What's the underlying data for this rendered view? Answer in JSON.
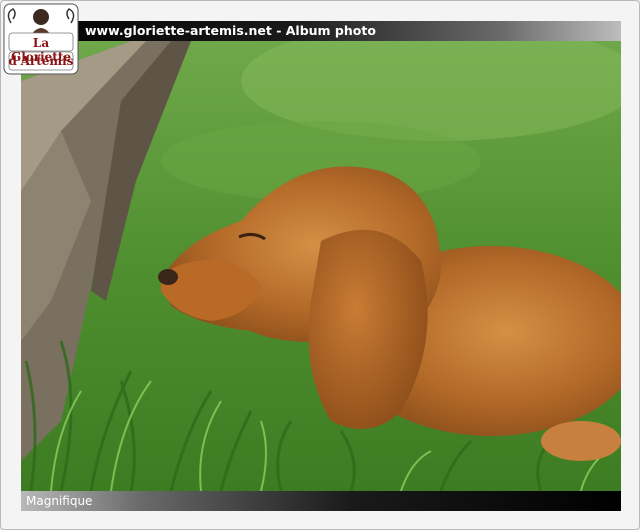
{
  "header": {
    "title": "www.gloriette-artemis.net - Album photo"
  },
  "caption": {
    "text": "Magnifique"
  },
  "logo": {
    "line1": "La Gloriette",
    "line2": "d'Artémis"
  },
  "photo": {
    "subject": "puppy-in-grass",
    "icon": "photo-image"
  },
  "colors": {
    "grass": "#4c8a2c",
    "fur": "#b06a2a",
    "frame": "#f4f4f4"
  }
}
